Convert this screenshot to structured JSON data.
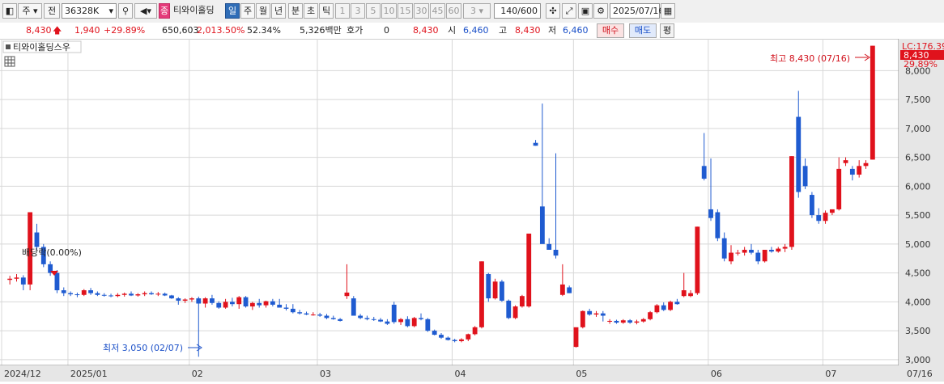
{
  "toolbar": {
    "market_label": "주",
    "prev_label": "전",
    "code_value": "36328K",
    "stock_name_prefix": "종",
    "stock_name": "티와이홀딩",
    "period_tabs": [
      "일",
      "주",
      "월",
      "년",
      "분",
      "초",
      "틱"
    ],
    "minute_options": [
      "1",
      "3",
      "5",
      "10",
      "15",
      "30",
      "45",
      "60"
    ],
    "custom_minute": "3",
    "count_value": "140/600",
    "date_value": "2025/07/16"
  },
  "infobar": {
    "price": "8,430",
    "change": "1,940",
    "change_pct": "+29.89%",
    "volume": "650,603",
    "volume_ratio": "2,013.50%",
    "turnover_ratio": "52.34%",
    "amount": "5,326백만",
    "hoga_label": "호가",
    "hoga_value": "0",
    "current": "8,430",
    "open_label": "시",
    "open_value": "6,460",
    "high_label": "고",
    "high_value": "8,430",
    "low_label": "저",
    "low_value": "6,460",
    "buy_label": "매수",
    "sell_label": "매도",
    "eval_label": "평"
  },
  "chart": {
    "legend_name": "티와이홀딩스우",
    "lc_label": "LC:176.39",
    "last_price_label": "8,430",
    "last_pct_label": "29.89%",
    "high_annotation": "최고 8,430 (07/16)",
    "low_annotation": "최저 3,050 (02/07)",
    "ex_rights_annotation": "배당락(0.00%)",
    "colors": {
      "up": "#e0121c",
      "down": "#1f5bd0",
      "grid": "#d8d8d8",
      "axis_bg": "#e6e6e6"
    }
  },
  "chart_data": {
    "type": "candlestick",
    "y_ticks": [
      "8,000",
      "7,500",
      "7,000",
      "6,500",
      "6,000",
      "5,500",
      "5,000",
      "4,500",
      "4,000",
      "3,500",
      "3,000"
    ],
    "y_range": [
      2900,
      8550
    ],
    "x_labels": [
      "2024/12",
      "2025/01",
      "02",
      "03",
      "04",
      "05",
      "06",
      "07",
      "07/16"
    ],
    "candles": [
      [
        4380,
        4450,
        4300,
        4400
      ],
      [
        4400,
        4480,
        4350,
        4420
      ],
      [
        4420,
        4460,
        4200,
        4300
      ],
      [
        4300,
        5550,
        4200,
        5550
      ],
      [
        5200,
        5350,
        4900,
        4950
      ],
      [
        4950,
        5000,
        4600,
        4650
      ],
      [
        4650,
        4700,
        4450,
        4500
      ],
      [
        4500,
        4550,
        4150,
        4200
      ],
      [
        4200,
        4250,
        4100,
        4150
      ],
      [
        4150,
        4180,
        4100,
        4130
      ],
      [
        4130,
        4160,
        4080,
        4120
      ],
      [
        4120,
        4220,
        4100,
        4200
      ],
      [
        4200,
        4240,
        4120,
        4150
      ],
      [
        4150,
        4180,
        4100,
        4120
      ],
      [
        4120,
        4150,
        4090,
        4110
      ],
      [
        4110,
        4140,
        4080,
        4100
      ],
      [
        4100,
        4150,
        4080,
        4120
      ],
      [
        4120,
        4160,
        4090,
        4140
      ],
      [
        4140,
        4180,
        4100,
        4110
      ],
      [
        4110,
        4150,
        4090,
        4130
      ],
      [
        4130,
        4180,
        4100,
        4150
      ],
      [
        4150,
        4180,
        4120,
        4130
      ],
      [
        4130,
        4170,
        4100,
        4140
      ],
      [
        4140,
        4160,
        4100,
        4110
      ],
      [
        4110,
        4120,
        4050,
        4060
      ],
      [
        4060,
        4080,
        3950,
        4020
      ],
      [
        4020,
        4060,
        3980,
        4040
      ],
      [
        4040,
        4080,
        4000,
        4060
      ],
      [
        4060,
        4090,
        3050,
        3970
      ],
      [
        3970,
        4080,
        3900,
        4060
      ],
      [
        4060,
        4120,
        3950,
        3980
      ],
      [
        3980,
        4010,
        3880,
        3900
      ],
      [
        3900,
        4050,
        3880,
        4000
      ],
      [
        4000,
        4070,
        3920,
        3960
      ],
      [
        3960,
        4100,
        3880,
        4080
      ],
      [
        4080,
        4100,
        3900,
        3920
      ],
      [
        3920,
        4000,
        3860,
        3980
      ],
      [
        3980,
        4050,
        3900,
        3940
      ],
      [
        3940,
        4020,
        3900,
        4010
      ],
      [
        4010,
        4050,
        3920,
        3950
      ],
      [
        3950,
        4050,
        3900,
        3900
      ],
      [
        3900,
        3960,
        3850,
        3880
      ],
      [
        3880,
        3960,
        3800,
        3820
      ],
      [
        3820,
        3860,
        3780,
        3800
      ],
      [
        3800,
        3830,
        3770,
        3780
      ],
      [
        3780,
        3820,
        3760,
        3780
      ],
      [
        3780,
        3810,
        3740,
        3760
      ],
      [
        3760,
        3790,
        3700,
        3720
      ],
      [
        3720,
        3760,
        3690,
        3700
      ],
      [
        3700,
        3720,
        3660,
        3670
      ],
      [
        4100,
        4650,
        4050,
        4160
      ],
      [
        4060,
        4100,
        3760,
        3760
      ],
      [
        3760,
        3790,
        3700,
        3720
      ],
      [
        3720,
        3760,
        3680,
        3700
      ],
      [
        3700,
        3740,
        3670,
        3690
      ],
      [
        3690,
        3720,
        3650,
        3660
      ],
      [
        3660,
        3700,
        3600,
        3620
      ],
      [
        3950,
        4000,
        3620,
        3650
      ],
      [
        3650,
        3720,
        3600,
        3700
      ],
      [
        3700,
        3750,
        3560,
        3580
      ],
      [
        3580,
        3740,
        3560,
        3720
      ],
      [
        3720,
        3800,
        3680,
        3700
      ],
      [
        3700,
        3720,
        3480,
        3500
      ],
      [
        3500,
        3520,
        3420,
        3430
      ],
      [
        3430,
        3460,
        3360,
        3380
      ],
      [
        3380,
        3400,
        3330,
        3340
      ],
      [
        3340,
        3360,
        3300,
        3320
      ],
      [
        3320,
        3370,
        3300,
        3350
      ],
      [
        3350,
        3450,
        3320,
        3440
      ],
      [
        3440,
        3580,
        3420,
        3560
      ],
      [
        3560,
        4700,
        3540,
        4700
      ],
      [
        4480,
        4500,
        4000,
        4060
      ],
      [
        4060,
        4400,
        4040,
        4350
      ],
      [
        4350,
        4380,
        4000,
        4020
      ],
      [
        4020,
        4040,
        3700,
        3720
      ],
      [
        3720,
        3940,
        3700,
        3920
      ],
      [
        3920,
        4120,
        3900,
        4100
      ],
      [
        3920,
        5180,
        3900,
        5180
      ],
      [
        6750,
        6800,
        6700,
        6700
      ],
      [
        5650,
        7430,
        5500,
        5000
      ],
      [
        5000,
        5100,
        4900,
        4900
      ],
      [
        4900,
        6570,
        4750,
        4800
      ],
      [
        4120,
        4650,
        4100,
        4300
      ],
      [
        4250,
        4280,
        4150,
        4150
      ],
      [
        3220,
        3550,
        3210,
        3560
      ],
      [
        3560,
        3850,
        3540,
        3840
      ],
      [
        3840,
        3880,
        3760,
        3780
      ],
      [
        3780,
        3840,
        3740,
        3800
      ],
      [
        3800,
        3840,
        3660,
        3760
      ],
      [
        3660,
        3700,
        3620,
        3670
      ],
      [
        3670,
        3690,
        3620,
        3640
      ],
      [
        3640,
        3700,
        3620,
        3680
      ],
      [
        3680,
        3700,
        3620,
        3640
      ],
      [
        3640,
        3690,
        3610,
        3660
      ],
      [
        3660,
        3720,
        3640,
        3700
      ],
      [
        3700,
        3840,
        3680,
        3820
      ],
      [
        3820,
        3960,
        3800,
        3940
      ],
      [
        3940,
        3990,
        3840,
        3860
      ],
      [
        3860,
        4020,
        3840,
        4000
      ],
      [
        4000,
        4050,
        3950,
        3960
      ],
      [
        4100,
        4500,
        4080,
        4200
      ],
      [
        4100,
        4200,
        4080,
        4150
      ],
      [
        4150,
        5300,
        4120,
        5300
      ],
      [
        6350,
        6920,
        6100,
        6130
      ],
      [
        5600,
        6480,
        5400,
        5450
      ],
      [
        5550,
        5600,
        5050,
        5100
      ],
      [
        5100,
        5200,
        4700,
        4750
      ],
      [
        4700,
        4980,
        4650,
        4850
      ],
      [
        4850,
        4900,
        4800,
        4850
      ],
      [
        4850,
        4950,
        4800,
        4900
      ],
      [
        4900,
        5000,
        4820,
        4850
      ],
      [
        4850,
        4900,
        4650,
        4700
      ],
      [
        4700,
        4900,
        4680,
        4900
      ],
      [
        4900,
        4950,
        4850,
        4870
      ],
      [
        4870,
        4950,
        4850,
        4920
      ],
      [
        4920,
        5000,
        4860,
        4950
      ],
      [
        4950,
        6520,
        4900,
        6520
      ],
      [
        7200,
        7650,
        5800,
        5900
      ],
      [
        6350,
        6480,
        5950,
        6000
      ],
      [
        5850,
        5900,
        5450,
        5500
      ],
      [
        5500,
        5620,
        5350,
        5400
      ],
      [
        5400,
        5580,
        5350,
        5540
      ],
      [
        5540,
        5600,
        5500,
        5600
      ],
      [
        5600,
        6500,
        5580,
        6300
      ],
      [
        6400,
        6500,
        6350,
        6450
      ],
      [
        6300,
        6350,
        6100,
        6200
      ],
      [
        6200,
        6450,
        6150,
        6350
      ],
      [
        6350,
        6450,
        6300,
        6400
      ],
      [
        6460,
        8430,
        6460,
        8430
      ]
    ]
  }
}
